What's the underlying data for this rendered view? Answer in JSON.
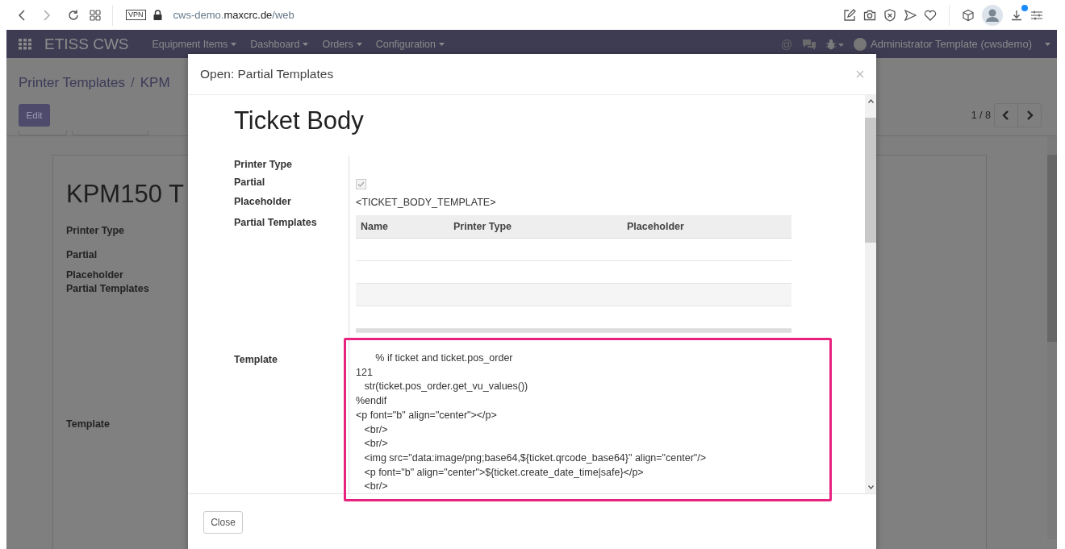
{
  "browser": {
    "vpn": "VPN",
    "url_prefix": "cws-demo.",
    "url_domain": "maxcrc.de",
    "url_path": "/web",
    "download_badge": true
  },
  "navbar": {
    "brand": "ETISS CWS",
    "menus": [
      "Equipment Items",
      "Dashboard",
      "Orders",
      "Configuration"
    ],
    "mention": "@",
    "user": "Administrator Template (cwsdemo)"
  },
  "background_page": {
    "breadcrumb": [
      "Printer Templates",
      "KPM"
    ],
    "breadcrumb_separator": "/",
    "edit_button": "Edit",
    "pager": "1 / 8",
    "record_title": "KPM150 T",
    "fields": [
      "Printer Type",
      "Partial",
      "Placeholder",
      "Partial Templates",
      "Template"
    ]
  },
  "dialog": {
    "title": "Open: Partial Templates",
    "record_name": "Ticket Body",
    "fields": [
      {
        "label": "Printer Type",
        "kind": "text"
      },
      {
        "label": "Partial",
        "kind": "checkbox",
        "checked": true
      },
      {
        "label": "Placeholder",
        "kind": "text",
        "value": "<TICKET_BODY_TEMPLATE>"
      },
      {
        "label": "Partial Templates",
        "kind": "table",
        "columns": [
          "Name",
          "Printer Type",
          "Placeholder"
        ]
      },
      {
        "label": "Template",
        "kind": "code",
        "highlighted": true,
        "lines": [
          "       % if ticket and ticket.pos_order",
          "121",
          "   str(ticket.pos_order.get_vu_values())",
          "%endif",
          "<p font=\"b\" align=\"center\"></p>",
          "   <br/>",
          "   <br/>",
          "   <img src=\"data:image/png;base64,${ticket.qrcode_base64}\" align=\"center\"/>",
          "   <p font=\"b\" align=\"center\">${ticket.create_date_time|safe}</p>",
          "   <br/>"
        ]
      }
    ],
    "close_button": "Close"
  }
}
